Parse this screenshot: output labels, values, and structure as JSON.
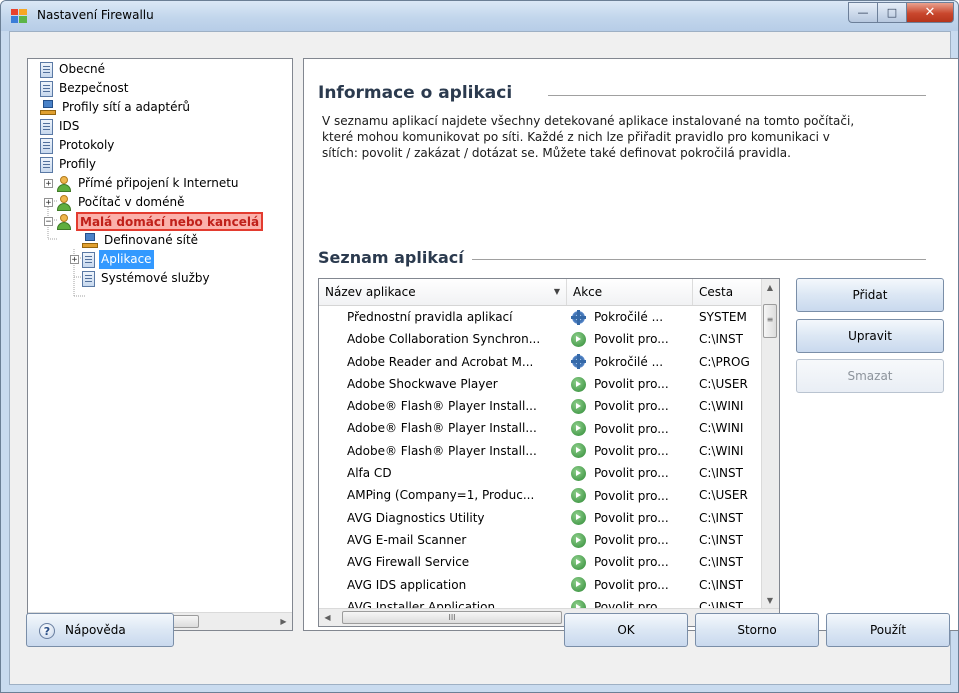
{
  "window": {
    "title": "Nastavení Firewallu",
    "buttons": {
      "minimize": "—",
      "maximize": "□",
      "close": "✕"
    }
  },
  "tree": {
    "items": [
      {
        "label": "Obecné",
        "icon": "document-icon"
      },
      {
        "label": "Bezpečnost",
        "icon": "document-icon"
      },
      {
        "label": "Profily sítí a adaptérů",
        "icon": "network-icon"
      },
      {
        "label": "IDS",
        "icon": "document-icon"
      },
      {
        "label": "Protokoly",
        "icon": "document-icon"
      },
      {
        "label": "Profily",
        "icon": "document-icon"
      },
      {
        "label": "Přímé připojení k Internetu",
        "icon": "user-icon",
        "expander": "+"
      },
      {
        "label": "Počítač v doméně",
        "icon": "user-icon",
        "expander": "+"
      },
      {
        "label": "Malá domácí nebo kancelá",
        "icon": "user-icon",
        "expander": "−",
        "highlighted": true
      },
      {
        "label": "Definované sítě",
        "icon": "network-icon"
      },
      {
        "label": "Aplikace",
        "icon": "document-icon",
        "expander": "+",
        "selected": true
      },
      {
        "label": "Systémové služby",
        "icon": "document-icon"
      }
    ],
    "scroll_thumb_glyph": "III",
    "scroll_left": "◀",
    "scroll_right": "▶"
  },
  "info": {
    "title": "Informace o aplikaci",
    "description_lines": [
      "V seznamu aplikací najdete všechny detekované aplikace instalované na tomto počítači,",
      "které mohou komunikovat po síti. Každé z nich lze přiřadit pravidlo pro komunikaci v",
      "sítích: povolit / zakázat / dotázat se. Můžete také definovat pokročilá pravidla."
    ]
  },
  "app_list": {
    "title": "Seznam aplikací",
    "columns": {
      "name": "Název aplikace",
      "action": "Akce",
      "path": "Cesta"
    },
    "sort_indicator": "▼",
    "rows": [
      {
        "name": "Přednostní pravidla aplikací",
        "action": "Pokročilé ...",
        "action_icon": "advanced",
        "path": "SYSTEM"
      },
      {
        "name": "Adobe Collaboration Synchron...",
        "action": "Povolit pro...",
        "action_icon": "allow",
        "path": "C:\\INST"
      },
      {
        "name": "Adobe Reader and Acrobat M...",
        "action": "Pokročilé ...",
        "action_icon": "advanced",
        "path": "C:\\PROG"
      },
      {
        "name": "Adobe Shockwave Player",
        "action": "Povolit pro...",
        "action_icon": "allow",
        "path": "C:\\USER"
      },
      {
        "name": "Adobe® Flash® Player Install...",
        "action": "Povolit pro...",
        "action_icon": "allow",
        "path": "C:\\WINI"
      },
      {
        "name": "Adobe® Flash® Player Install...",
        "action": "Povolit pro...",
        "action_icon": "allow",
        "path": "C:\\WINI"
      },
      {
        "name": "Adobe® Flash® Player Install...",
        "action": "Povolit pro...",
        "action_icon": "allow",
        "path": "C:\\WINI"
      },
      {
        "name": "Alfa CD",
        "action": "Povolit pro...",
        "action_icon": "allow",
        "path": "C:\\INST"
      },
      {
        "name": "AMPing (Company=1, Produc...",
        "action": "Povolit pro...",
        "action_icon": "allow",
        "path": "C:\\USER"
      },
      {
        "name": "AVG Diagnostics Utility",
        "action": "Povolit pro...",
        "action_icon": "allow",
        "path": "C:\\INST"
      },
      {
        "name": "AVG E-mail Scanner",
        "action": "Povolit pro...",
        "action_icon": "allow",
        "path": "C:\\INST"
      },
      {
        "name": "AVG Firewall Service",
        "action": "Povolit pro...",
        "action_icon": "allow",
        "path": "C:\\INST"
      },
      {
        "name": "AVG IDS application",
        "action": "Povolit pro...",
        "action_icon": "allow",
        "path": "C:\\INST"
      },
      {
        "name": "AVG Installer Application",
        "action": "Povolit pro...",
        "action_icon": "allow",
        "path": "C:\\INST"
      }
    ],
    "scroll_thumb_glyph": "III",
    "vscroll_thumb_glyph": "≡",
    "scroll_up": "▲",
    "scroll_down": "▼",
    "scroll_left": "◀",
    "scroll_right": "▶"
  },
  "side_buttons": {
    "add": "Přidat",
    "edit": "Upravit",
    "delete": "Smazat"
  },
  "footer": {
    "help": "Nápověda",
    "help_glyph": "?",
    "ok": "OK",
    "cancel": "Storno",
    "apply": "Použít"
  },
  "colors": {
    "selection": "#3399ff",
    "highlight_border": "#e33b2f",
    "highlight_fill": "#fbb1ab"
  }
}
